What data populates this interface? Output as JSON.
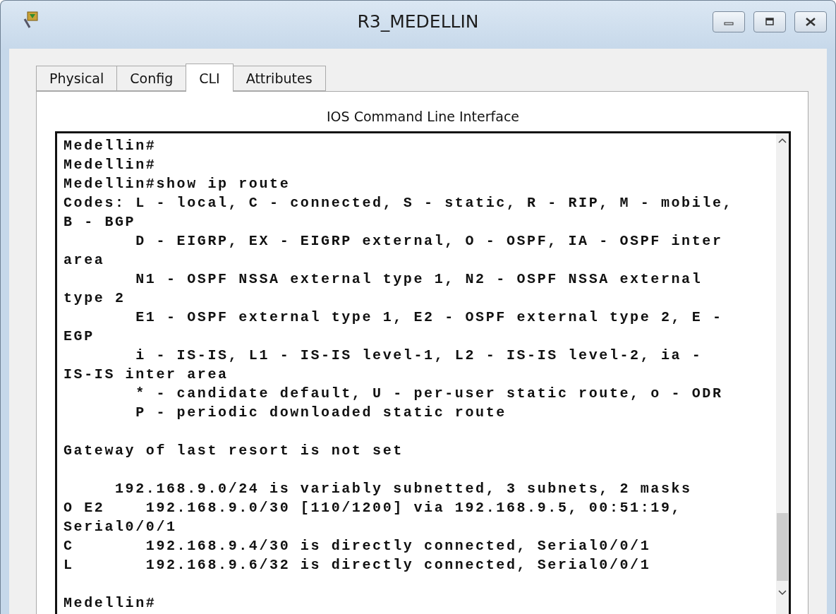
{
  "window": {
    "title": "R3_MEDELLIN"
  },
  "tabs": [
    {
      "label": "Physical",
      "selected": false
    },
    {
      "label": "Config",
      "selected": false
    },
    {
      "label": "CLI",
      "selected": true
    },
    {
      "label": "Attributes",
      "selected": false
    }
  ],
  "panel_title": "IOS Command Line Interface",
  "terminal": {
    "lines": [
      {
        "kind": "text",
        "text": "Medellin#"
      },
      {
        "kind": "text",
        "text": "Medellin#"
      },
      {
        "kind": "text",
        "text": "Medellin#show ip route"
      },
      {
        "kind": "text",
        "text": "Codes: L - local, C - connected, S - static, R - RIP, M - mobile,"
      },
      {
        "kind": "text",
        "text": "B - BGP"
      },
      {
        "kind": "text",
        "text": "       D - EIGRP, EX - EIGRP external, O - OSPF, IA - OSPF inter"
      },
      {
        "kind": "text",
        "text": "area"
      },
      {
        "kind": "text",
        "text": "       N1 - OSPF NSSA external type 1, N2 - OSPF NSSA external"
      },
      {
        "kind": "text",
        "text": "type 2"
      },
      {
        "kind": "text",
        "text": "       E1 - OSPF external type 1, E2 - OSPF external type 2, E -"
      },
      {
        "kind": "text",
        "text": "EGP"
      },
      {
        "kind": "text",
        "text": "       i - IS-IS, L1 - IS-IS level-1, L2 - IS-IS level-2, ia -"
      },
      {
        "kind": "text",
        "text": "IS-IS inter area"
      },
      {
        "kind": "text",
        "text": "       * - candidate default, U - per-user static route, o - ODR"
      },
      {
        "kind": "text",
        "text": "       P - periodic downloaded static route"
      },
      {
        "kind": "blank"
      },
      {
        "kind": "text",
        "text": "Gateway of last resort is not set"
      },
      {
        "kind": "blank"
      },
      {
        "kind": "text",
        "text": "     192.168.9.0/24 is variably subnetted, 3 subnets, 2 masks"
      },
      {
        "kind": "text",
        "text": "O E2    192.168.9.0/30 [110/1200] via 192.168.9.5, 00:51:19,"
      },
      {
        "kind": "text",
        "text": "Serial0/0/1"
      },
      {
        "kind": "text",
        "text": "C       192.168.9.4/30 is directly connected, Serial0/0/1"
      },
      {
        "kind": "text",
        "text": "L       192.168.9.6/32 is directly connected, Serial0/0/1"
      },
      {
        "kind": "blank"
      },
      {
        "kind": "text",
        "text": "Medellin#"
      }
    ]
  }
}
